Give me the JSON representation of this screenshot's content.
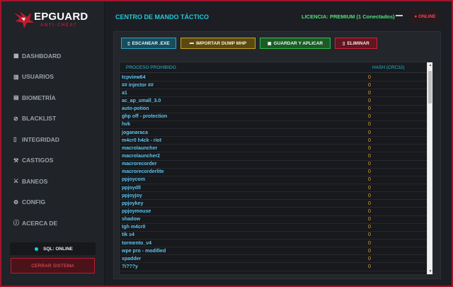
{
  "brand": {
    "name": "EPGUARD",
    "tagline": "ANTI-CHEAT",
    "accent_color": "#c0192e"
  },
  "header": {
    "title": "CENTRO DE MANDO TÁCTICO",
    "license": "LICENCIA: PREMIUM (1 Conectados)",
    "status": "● ONLINE"
  },
  "sidebar": {
    "items": [
      {
        "icon": "dashboard-icon",
        "label": "DASHBOARD"
      },
      {
        "icon": "users-icon",
        "label": "USUARIOS"
      },
      {
        "icon": "fingerprint-icon",
        "label": "BIOMETRÍA"
      },
      {
        "icon": "ban-icon",
        "label": "BLACKLIST"
      },
      {
        "icon": "file-icon",
        "label": "INTEGRIDAD"
      },
      {
        "icon": "gavel-icon",
        "label": "CASTIGOS"
      },
      {
        "icon": "hammer-icon",
        "label": "BANEOS"
      },
      {
        "icon": "gear-icon",
        "label": "CONFIG"
      },
      {
        "icon": "info-icon",
        "label": "ACERCA DE"
      }
    ],
    "sql_status": "SQL: ONLINE",
    "logout_label": "CERRAR SISTEMA"
  },
  "toolbar": {
    "scan_label": "ESCANEAR .EXE",
    "import_label": "IMPORTAR DUMP MHP",
    "save_label": "GUARDAR Y APLICAR",
    "delete_label": "ELIMINAR"
  },
  "table": {
    "columns": [
      "PROCESO PROHIBIDO",
      "HASH (CRC32)"
    ],
    "rows": [
      {
        "process": "tcpview64",
        "hash": "0"
      },
      {
        "process": "## injector ##",
        "hash": "0"
      },
      {
        "process": "a1",
        "hash": "0"
      },
      {
        "process": "ac_ap_small_3.0",
        "hash": "0"
      },
      {
        "process": "auto-potion",
        "hash": "0"
      },
      {
        "process": "ghp off - protection",
        "hash": "0"
      },
      {
        "process": "hvk",
        "hash": "0"
      },
      {
        "process": "joganaraca",
        "hash": "0"
      },
      {
        "process": "m4cr0 h4ck - riot",
        "hash": "0"
      },
      {
        "process": "macrolauncher",
        "hash": "0"
      },
      {
        "process": "macrolauncher2",
        "hash": "0"
      },
      {
        "process": "macrorecorder",
        "hash": "0"
      },
      {
        "process": "macrorecorderlite",
        "hash": "0"
      },
      {
        "process": "ppjoycom",
        "hash": "0"
      },
      {
        "process": "ppjoydll",
        "hash": "0"
      },
      {
        "process": "ppjoyjoy",
        "hash": "0"
      },
      {
        "process": "ppjoykey",
        "hash": "0"
      },
      {
        "process": "ppjoymouse",
        "hash": "0"
      },
      {
        "process": "shadow",
        "hash": "0"
      },
      {
        "process": "tgh m4cr0",
        "hash": "0"
      },
      {
        "process": "tik s4",
        "hash": "0"
      },
      {
        "process": "tormento_v4",
        "hash": "0"
      },
      {
        "process": "wpe pro - modified",
        "hash": "0"
      },
      {
        "process": "xpadder",
        "hash": "0"
      },
      {
        "process": "?i???y",
        "hash": "0"
      }
    ]
  }
}
